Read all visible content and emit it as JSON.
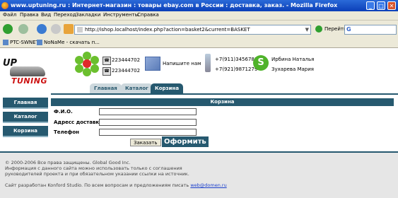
{
  "window": {
    "title": "www.uptuning.ru : Интернет-магазин : товары ebay.com в России : доставка, заказ. - Mozilla Firefox",
    "controls": {
      "minimize": "_",
      "maximize": "□",
      "close": "✕"
    }
  },
  "menu": [
    "Файл",
    "Правка",
    "Вид",
    "Переход",
    "Закладки",
    "Инструменты",
    "Справка"
  ],
  "nav": {
    "url": "http://ishop.localhost/index.php?action=basket2&current=BASKET",
    "go_label": "Перейти",
    "search_logo": "G"
  },
  "bookmarks": [
    "PTC-SWNET",
    "NoNaMe - скачать п..."
  ],
  "header": {
    "logo_top": "UP",
    "logo_bottom": "TUNING",
    "icq_numbers": [
      "223444702",
      "223444702"
    ],
    "write_us": "Напишите нам",
    "phones": [
      "+7(911)3456781",
      "+7(921)9871279"
    ],
    "contacts": [
      "Ирбина Наталья",
      "Зухарева Мария"
    ]
  },
  "tabs": [
    {
      "label": "Главная",
      "active": false
    },
    {
      "label": "Каталог",
      "active": false
    },
    {
      "label": "Корзина",
      "active": true
    }
  ],
  "sidebar": [
    "Главная",
    "Каталог",
    "Корзина"
  ],
  "panel": {
    "title": "Корзина",
    "fields": [
      {
        "label": "Ф.И.О.",
        "value": ""
      },
      {
        "label": "Адресс доставки",
        "value": ""
      },
      {
        "label": "Телефон",
        "value": ""
      }
    ],
    "order_button": "Заказать",
    "checkout_button": "Оформить"
  },
  "footer": {
    "line1": "© 2000-2006 Все права защищены. Global Good Inc.",
    "line2": "Информация с данного сайта можно использовать только с соглашения",
    "line3": "руководителей проекта и при обязательном указании ссылки на источник.",
    "line4": "Сайт разработан Konford Studio. По всем вопросам и предложениям писать",
    "email": "web@domen.ru"
  },
  "colors": {
    "accent": "#26596f",
    "titlebar": "#0b3fb8",
    "chrome": "#ece9d8"
  }
}
